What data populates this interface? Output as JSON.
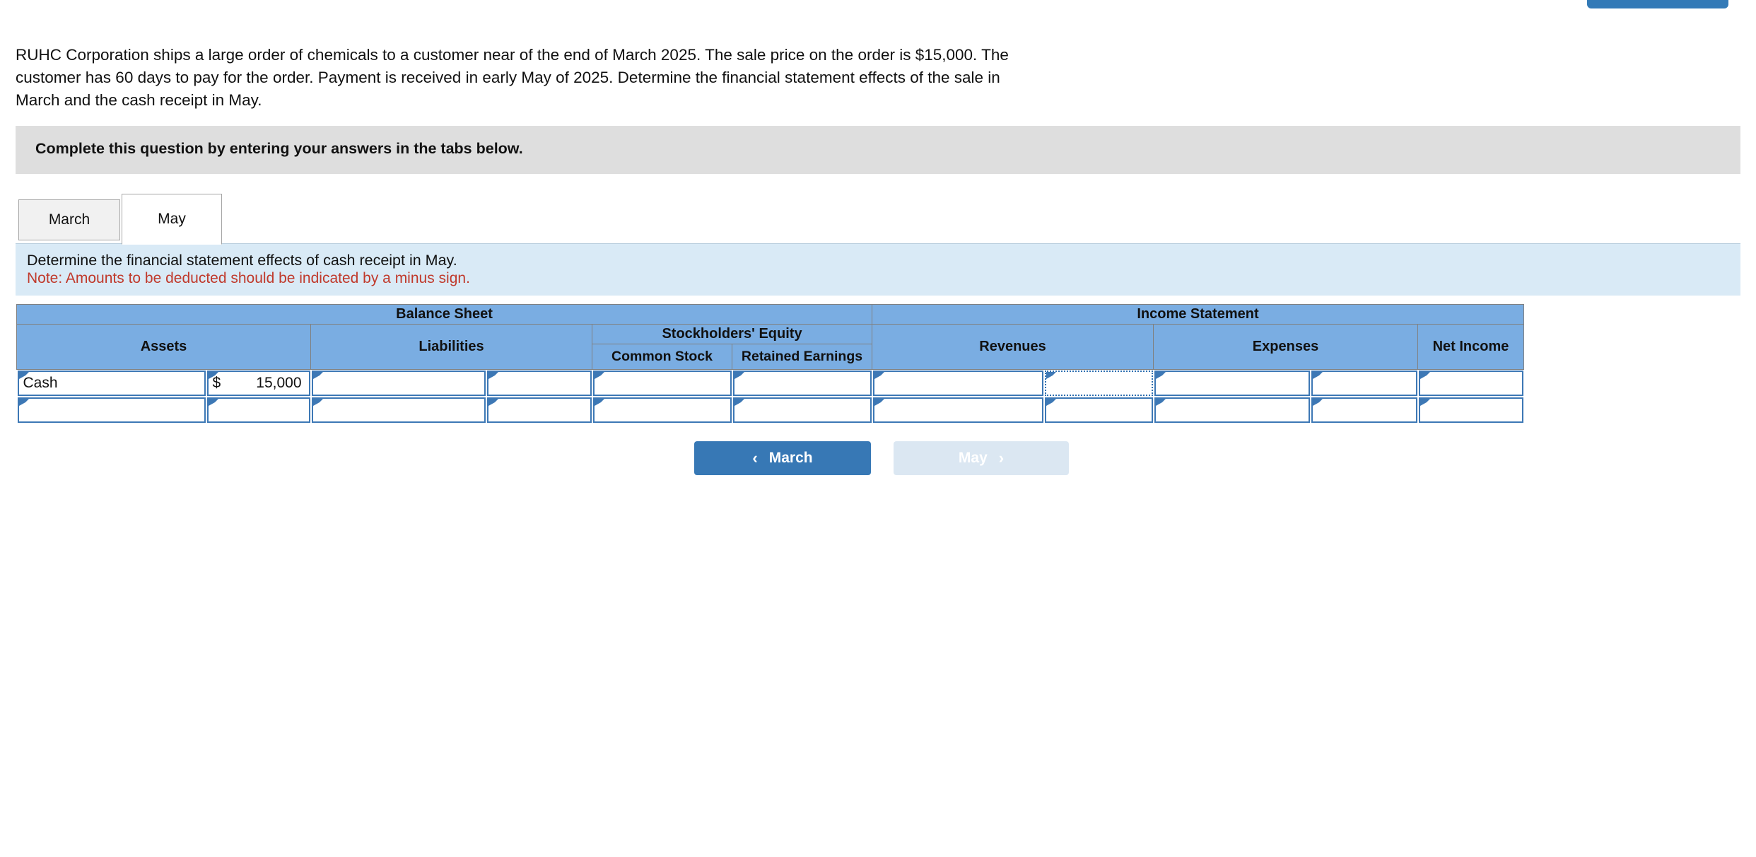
{
  "top_pill": {
    "name": "partial-blue-button"
  },
  "question": {
    "text": "RUHC Corporation ships a large order of chemicals to a customer near of the end of March 2025. The sale price on the order is $15,000. The customer has 60 days to pay for the order. Payment is received in early May of 2025. Determine the financial statement effects of the sale in March and the cash receipt in May."
  },
  "gray_banner": {
    "text": "Complete this question by entering your answers in the tabs below."
  },
  "tabs": [
    {
      "label": "March",
      "active": false
    },
    {
      "label": "May",
      "active": true
    }
  ],
  "instructions": {
    "line1": "Determine the financial statement effects of cash receipt in May.",
    "line2": "Note: Amounts to be deducted should be indicated by a minus sign."
  },
  "table": {
    "group_headers": [
      {
        "label": "Balance Sheet",
        "colspan": 6
      },
      {
        "label": "Income Statement",
        "colspan": 5
      }
    ],
    "section_headers": [
      {
        "label": "Assets",
        "colspan": 2,
        "rowspan": 2
      },
      {
        "label": "Liabilities",
        "colspan": 2,
        "rowspan": 2
      },
      {
        "label": "Stockholders' Equity",
        "colspan": 2,
        "rowspan": 1
      },
      {
        "label": "Revenues",
        "colspan": 2,
        "rowspan": 2
      },
      {
        "label": "Expenses",
        "colspan": 2,
        "rowspan": 2
      },
      {
        "label": "Net Income",
        "colspan": 1,
        "rowspan": 2
      }
    ],
    "equity_subheaders": [
      {
        "label": "Common Stock"
      },
      {
        "label": "Retained Earnings"
      }
    ],
    "rows": [
      {
        "cells": [
          {
            "value": "Cash",
            "type": "text",
            "focused": false
          },
          {
            "value": "15,000",
            "symbol": "$",
            "type": "money",
            "focused": false
          },
          {
            "value": "",
            "type": "text",
            "focused": false
          },
          {
            "value": "",
            "type": "money",
            "focused": false
          },
          {
            "value": "",
            "type": "money",
            "focused": false
          },
          {
            "value": "",
            "type": "money",
            "focused": false
          },
          {
            "value": "",
            "type": "text",
            "focused": false
          },
          {
            "value": "",
            "type": "money",
            "focused": true
          },
          {
            "value": "",
            "type": "text",
            "focused": false
          },
          {
            "value": "",
            "type": "money",
            "focused": false
          },
          {
            "value": "",
            "type": "money",
            "focused": false
          }
        ]
      },
      {
        "cells": [
          {
            "value": "",
            "type": "text",
            "focused": false
          },
          {
            "value": "",
            "type": "money",
            "focused": false
          },
          {
            "value": "",
            "type": "text",
            "focused": false
          },
          {
            "value": "",
            "type": "money",
            "focused": false
          },
          {
            "value": "",
            "type": "money",
            "focused": false
          },
          {
            "value": "",
            "type": "money",
            "focused": false
          },
          {
            "value": "",
            "type": "text",
            "focused": false
          },
          {
            "value": "",
            "type": "money",
            "focused": false
          },
          {
            "value": "",
            "type": "text",
            "focused": false
          },
          {
            "value": "",
            "type": "money",
            "focused": false
          },
          {
            "value": "",
            "type": "money",
            "focused": false
          }
        ]
      }
    ]
  },
  "nav": {
    "prev": {
      "label": "March",
      "icon": "chevron-left-icon",
      "glyph": "‹",
      "enabled": true
    },
    "next": {
      "label": "May",
      "icon": "chevron-right-icon",
      "glyph": "›",
      "enabled": false
    }
  },
  "colors": {
    "header_blue": "#7aade2",
    "instruction_blue": "#d9eaf6",
    "gray_banner": "#dedede",
    "cell_border_blue": "#3d78b5",
    "button_blue": "#3778b5",
    "button_disabled": "#dbe7f2",
    "note_red": "#c0392b"
  }
}
